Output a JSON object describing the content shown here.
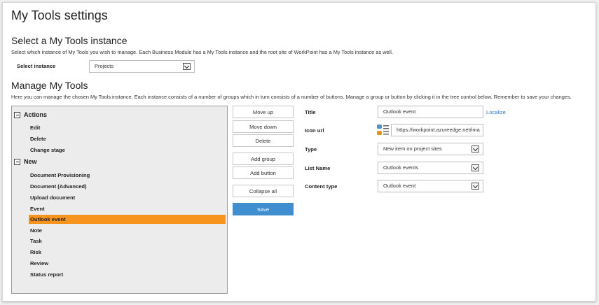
{
  "page": {
    "title": "My Tools settings"
  },
  "select_section": {
    "heading": "Select a My Tools instance",
    "description": "Select which instance of My Tools you wish to manage. Each Business Module has a My Tools instance and the root site of WorkPoint has a My Tools instance as well.",
    "label": "Select instance",
    "value": "Projects"
  },
  "manage_section": {
    "heading": "Manage My Tools",
    "description": "Here you can manage the chosen My Tools instance. Each instance consists of a number of groups which in turn consists of a number of buttons. Manage a group or button by clicking it in the tree control below. Remember to save your changes."
  },
  "tree": {
    "groups": [
      {
        "label": "Actions",
        "items": [
          "Edit",
          "Delete",
          "Change stage"
        ]
      },
      {
        "label": "New",
        "items": [
          "Document Provisioning",
          "Document (Advanced)",
          "Upload document",
          "Event",
          "Outlook event",
          "Note",
          "Task",
          "Risk",
          "Review",
          "Status report"
        ]
      }
    ],
    "selected": "Outlook event"
  },
  "buttons": {
    "move_up": "Move up",
    "move_down": "Move down",
    "delete": "Delete",
    "add_group": "Add group",
    "add_button": "Add button",
    "collapse_all": "Collapse all",
    "save": "Save"
  },
  "form": {
    "title_label": "Title",
    "title_value": "Outlook event",
    "localize": "Localize",
    "icon_label": "Icon url",
    "icon_value": "https://workpoint.azureedge.net/ima",
    "type_label": "Type",
    "type_value": "New item on project sites",
    "list_label": "List Name",
    "list_value": "Outlook events",
    "ct_label": "Content type",
    "ct_value": "Outlook event"
  },
  "colors": {
    "selected": "#f7941d",
    "primary": "#3e8ed0",
    "link": "#2a7ad1"
  }
}
